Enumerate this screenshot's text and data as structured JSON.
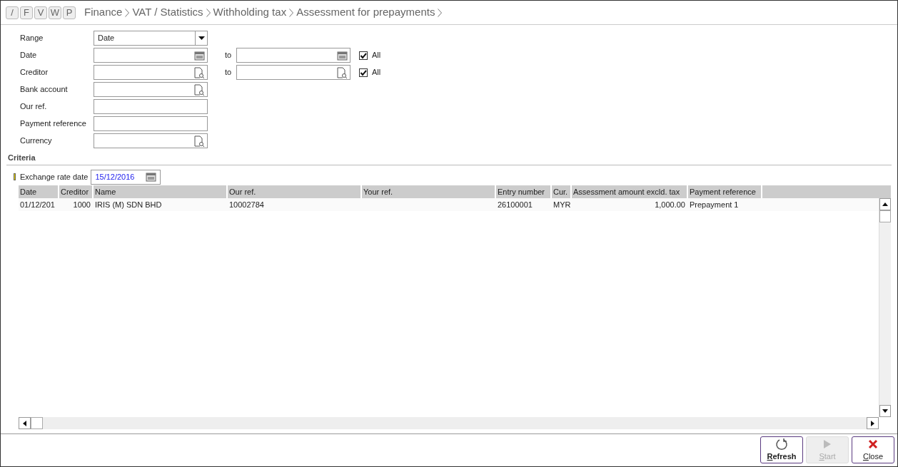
{
  "mode_buttons": [
    {
      "label": "/"
    },
    {
      "label": "F"
    },
    {
      "label": "V"
    },
    {
      "label": "W"
    },
    {
      "label": "P"
    }
  ],
  "breadcrumb": [
    "Finance",
    "VAT / Statistics",
    "Withholding tax",
    "Assessment for prepayments"
  ],
  "form": [
    {
      "kind": "dropdown",
      "label": "Range",
      "value": "Date"
    },
    {
      "kind": "date_range",
      "label": "Date",
      "to_label": "to",
      "all_label": "All",
      "all_checked": true
    },
    {
      "kind": "lookup_range",
      "label": "Creditor",
      "to_label": "to",
      "all_label": "All",
      "all_checked": true
    },
    {
      "kind": "lookup",
      "label": "Bank account"
    },
    {
      "kind": "text",
      "label": "Our ref."
    },
    {
      "kind": "text",
      "label": "Payment reference"
    },
    {
      "kind": "lookup",
      "label": "Currency"
    }
  ],
  "criteria": {
    "title": "Criteria",
    "exchange_rate_label": "Exchange rate date",
    "exchange_rate_value": "15/12/2016"
  },
  "table": {
    "columns": [
      {
        "label": "Date",
        "kind": "text"
      },
      {
        "label": "Creditor",
        "kind": "number"
      },
      {
        "label": "Name",
        "kind": "text"
      },
      {
        "label": "Our ref.",
        "kind": "text"
      },
      {
        "label": "Your ref.",
        "kind": "text"
      },
      {
        "label": "Entry number",
        "kind": "text"
      },
      {
        "label": "Cur.",
        "kind": "text"
      },
      {
        "label": "Assessment amount excld. tax",
        "kind": "number"
      },
      {
        "label": "Payment reference",
        "kind": "text"
      }
    ],
    "rows": [
      [
        "01/12/201",
        "1000",
        "IRIS (M) SDN BHD",
        "10002784",
        "",
        "26100001",
        "MYR",
        "1,000.00",
        "Prepayment 1"
      ]
    ]
  },
  "buttons": [
    {
      "kind": "refresh",
      "key": "R",
      "rest": "efresh",
      "disabled": false
    },
    {
      "kind": "start",
      "key": "S",
      "rest": "tart",
      "disabled": true
    },
    {
      "kind": "close",
      "key": "C",
      "rest": "lose",
      "disabled": false
    }
  ]
}
